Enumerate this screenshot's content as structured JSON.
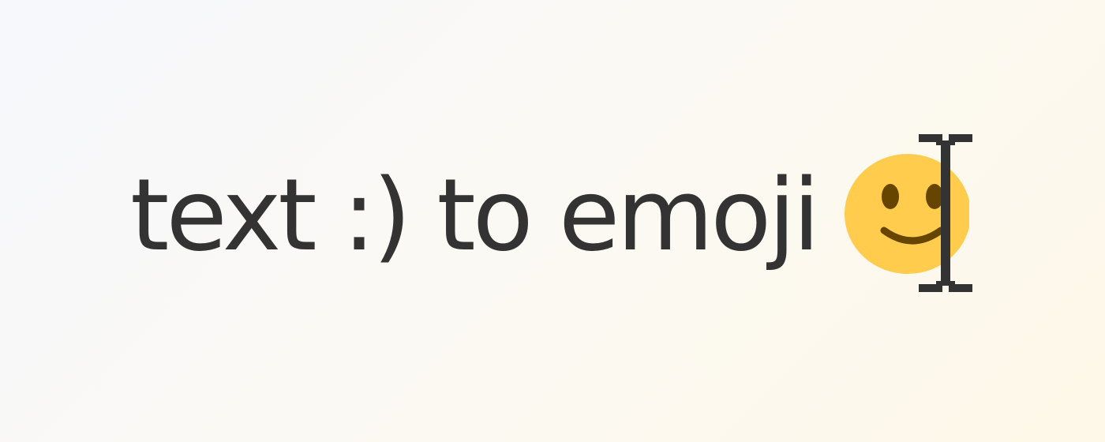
{
  "headline": {
    "text": "text :) to emoji"
  },
  "emoji": {
    "icon": "smiley-face-icon",
    "face_color": "#FFCC4D",
    "feature_color": "#664500"
  },
  "cursor": {
    "icon": "text-cursor-ibeam-icon",
    "color": "#333333"
  }
}
